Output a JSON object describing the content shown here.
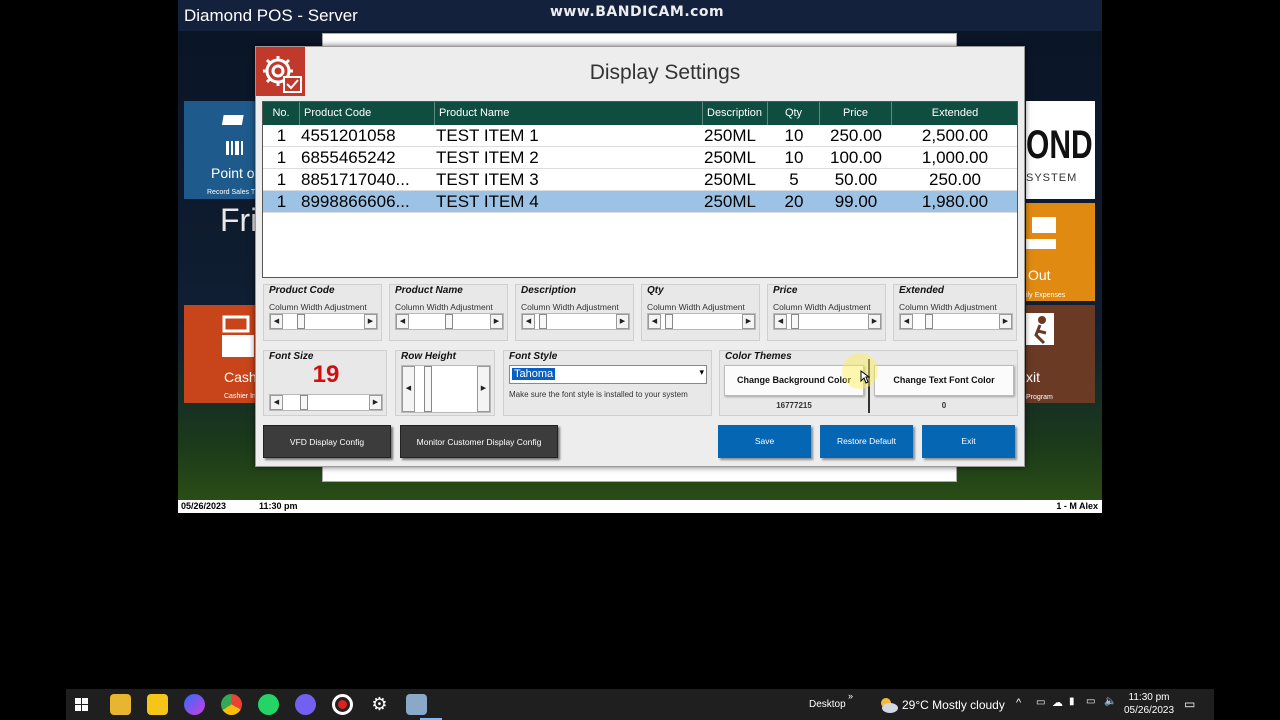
{
  "window": {
    "title": "Diamond POS - Server",
    "watermark": "www.BANDICAM.com"
  },
  "background_tiles": {
    "point_of_sale": {
      "label": "Point o",
      "sub": "Record Sales T"
    },
    "cash": {
      "label": "Cash",
      "sub": "Cashier In"
    },
    "brand": {
      "label": "OND",
      "sub": "SYSTEM"
    },
    "cash_out": {
      "label": "Out",
      "sub": "ily Expenses"
    },
    "exit": {
      "label": "xit",
      "sub": "Program"
    },
    "day_text": "Fri"
  },
  "status_bar": {
    "date": "05/26/2023",
    "time": "11:30 pm",
    "user": "1 - M Alex"
  },
  "dialog": {
    "title": "Display Settings",
    "grid": {
      "columns": [
        "No.",
        "Product Code",
        "Product Name",
        "Description",
        "Qty",
        "Price",
        "Extended"
      ],
      "rows": [
        {
          "no": "1",
          "code": "4551201058",
          "name": "TEST ITEM 1",
          "desc": "250ML",
          "qty": "10",
          "price": "250.00",
          "extended": "2,500.00"
        },
        {
          "no": "1",
          "code": "6855465242",
          "name": "TEST ITEM 2",
          "desc": "250ML",
          "qty": "10",
          "price": "100.00",
          "extended": "1,000.00"
        },
        {
          "no": "1",
          "code": "8851717040...",
          "name": "TEST ITEM 3",
          "desc": "250ML",
          "qty": "5",
          "price": "50.00",
          "extended": "250.00"
        },
        {
          "no": "1",
          "code": "8998866606...",
          "name": "TEST ITEM 4",
          "desc": "250ML",
          "qty": "20",
          "price": "99.00",
          "extended": "1,980.00"
        }
      ]
    },
    "width_groups": [
      {
        "title": "Product Code",
        "sub": "Column Width Adjustment"
      },
      {
        "title": "Product Name",
        "sub": "Column Width Adjustment"
      },
      {
        "title": "Description",
        "sub": "Column Width Adjustment"
      },
      {
        "title": "Qty",
        "sub": "Column Width Adjustment"
      },
      {
        "title": "Price",
        "sub": "Column Width Adjustment"
      },
      {
        "title": "Extended",
        "sub": "Column Width Adjustment"
      }
    ],
    "font_size": {
      "title": "Font Size",
      "value": "19",
      "value_color": "#d01010"
    },
    "row_height": {
      "title": "Row Height"
    },
    "font_style": {
      "title": "Font Style",
      "selected": "Tahoma",
      "note": "Make sure the font style is installed to your system"
    },
    "color_themes": {
      "title": "Color Themes",
      "bg_button": "Change Background Color",
      "text_button": "Change Text Font Color",
      "bg_value": "16777215",
      "text_value": "0"
    },
    "buttons": {
      "vfd": "VFD Display Config",
      "monitor": "Monitor Customer Display Config",
      "save": "Save",
      "restore": "Restore Default",
      "exit": "Exit"
    }
  },
  "taskbar": {
    "desktop_label": "Desktop",
    "weather": "29°C  Mostly cloudy",
    "time": "11:30 pm",
    "date": "05/26/2023"
  },
  "colors": {
    "grid_header": "#0e4d3f",
    "selected_row": "#9cc3e5",
    "action_blue": "#0567b3",
    "dialog_icon": "#c0392b"
  }
}
